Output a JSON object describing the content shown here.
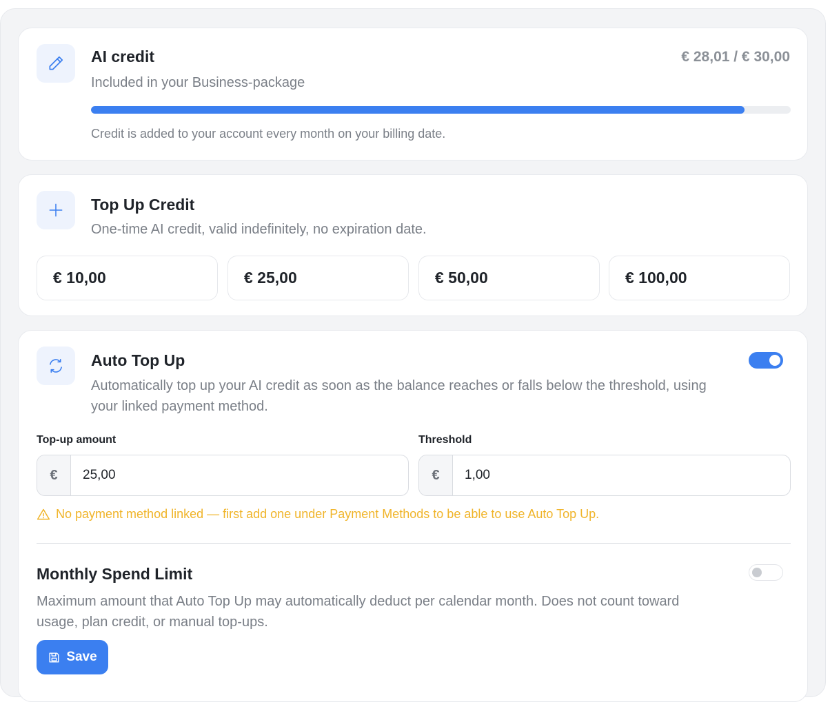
{
  "ai_credit": {
    "title": "AI credit",
    "subtitle": "Included in your Business-package",
    "amount": "€ 28,01 / € 30,00",
    "progress_fraction": 0.9337,
    "note": "Credit is added to your account every month on your billing date."
  },
  "top_up": {
    "title": "Top Up Credit",
    "subtitle": "One-time AI credit, valid indefinitely, no expiration date.",
    "options": [
      "€ 10,00",
      "€ 25,00",
      "€ 50,00",
      "€ 100,00"
    ]
  },
  "auto_top_up": {
    "title": "Auto Top Up",
    "description": "Automatically top up your AI credit as soon as the balance reaches or falls below the threshold, using your linked payment method.",
    "enabled": true,
    "amount_label": "Top-up amount",
    "amount_prefix": "€",
    "amount_value": "25,00",
    "threshold_label": "Threshold",
    "threshold_prefix": "€",
    "threshold_value": "1,00",
    "warning": "No payment method linked — first add one under Payment Methods to be able to use Auto Top Up."
  },
  "monthly_limit": {
    "title": "Monthly Spend Limit",
    "description": "Maximum amount that Auto Top Up may automatically deduct per calendar month. Does not count toward usage, plan credit, or manual top-ups.",
    "enabled": false
  },
  "save_label": "Save",
  "colors": {
    "accent": "#3b7ff0",
    "warning": "#f0b429",
    "icon_bg": "#eef3fd"
  },
  "icons": {
    "ai_credit": "pencil-icon",
    "top_up": "plus-icon",
    "auto_top_up": "refresh-icon",
    "warning": "warning-triangle-icon",
    "save": "floppy-disk-icon"
  }
}
